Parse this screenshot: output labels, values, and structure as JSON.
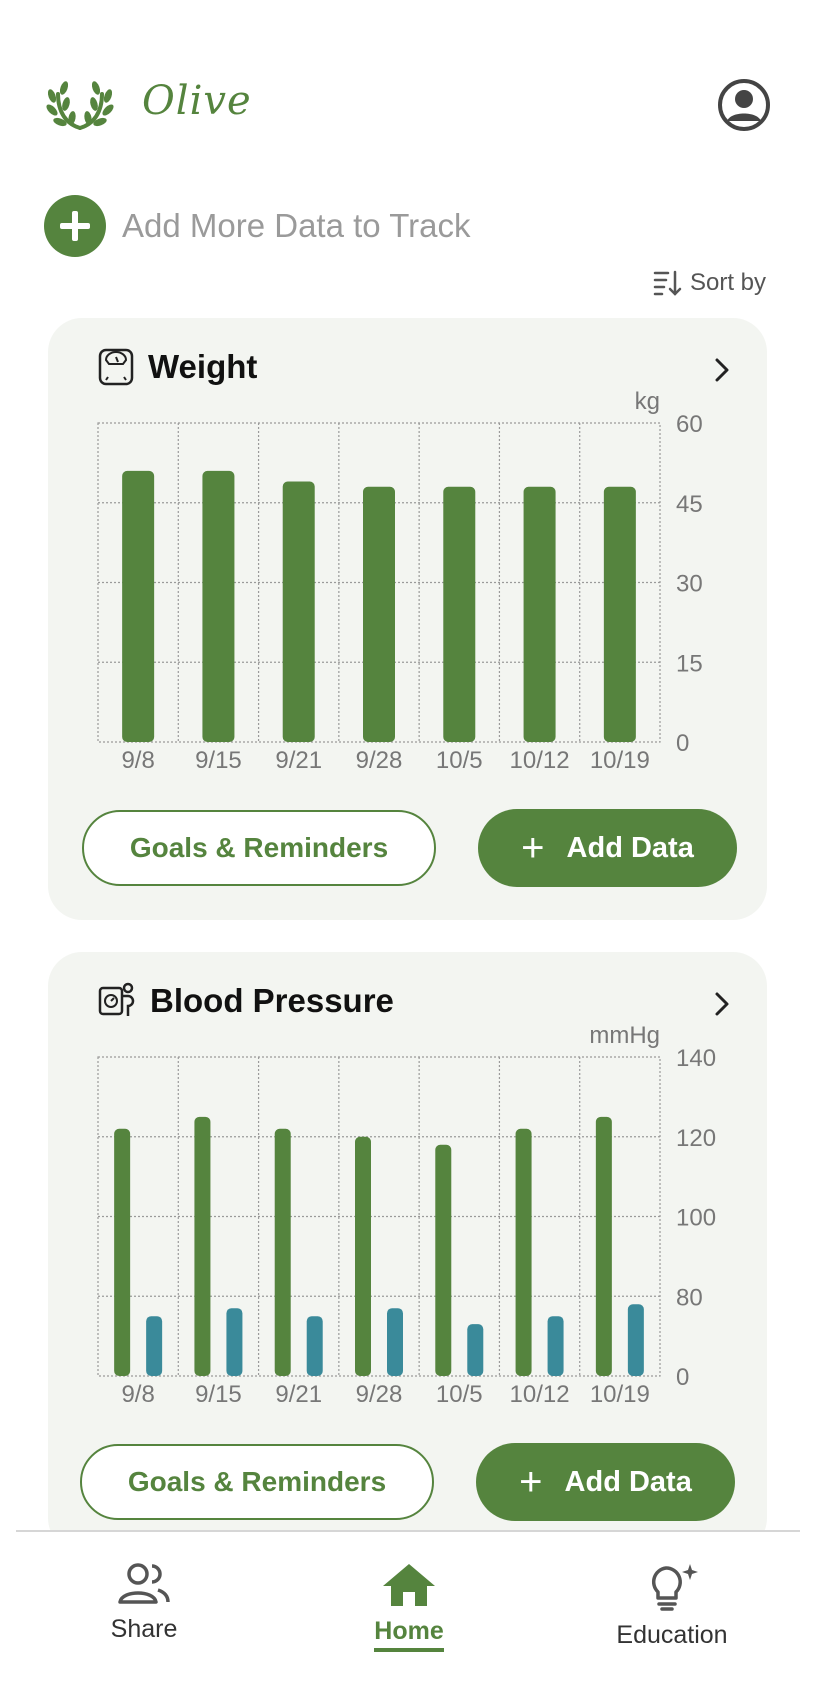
{
  "app": {
    "name": "Olive"
  },
  "header": {
    "logo_icon": "laurel-wreath-icon",
    "profile_icon": "user-circle-icon"
  },
  "add_more": {
    "label": "Add More Data to Track",
    "icon": "plus-circle-icon"
  },
  "sort": {
    "label": "Sort by",
    "icon": "sort-descending-icon"
  },
  "colors": {
    "primary": "#55843e",
    "secondary_bar": "#3a8a9a",
    "card_bg": "#f3f5f1",
    "muted_text": "#9a9a9a"
  },
  "weight_card": {
    "title": "Weight",
    "icon": "scale-icon",
    "goals_label": "Goals & Reminders",
    "add_label": "Add Data",
    "chart_data": {
      "type": "bar",
      "ylabel": "kg",
      "categories": [
        "9/8",
        "9/15",
        "9/21",
        "9/28",
        "10/5",
        "10/12",
        "10/19"
      ],
      "yticks": [
        "0",
        "15",
        "30",
        "45",
        "60"
      ],
      "ylim": [
        0,
        60
      ],
      "grid": true,
      "series": [
        {
          "values": [
            51,
            51,
            49,
            48,
            48,
            48,
            48
          ]
        }
      ]
    }
  },
  "bp_card": {
    "title": "Blood Pressure",
    "icon": "blood-pressure-monitor-icon",
    "goals_label": "Goals & Reminders",
    "add_label": "Add Data",
    "chart_data": {
      "type": "bar",
      "ylabel": "mmHg",
      "categories": [
        "9/8",
        "9/15",
        "9/21",
        "9/28",
        "10/5",
        "10/12",
        "10/19"
      ],
      "yticks": [
        "0",
        "80",
        "100",
        "120",
        "140"
      ],
      "ylim": [
        60,
        140
      ],
      "grid": true,
      "series": [
        {
          "values": [
            122,
            125,
            122,
            120,
            118,
            122,
            125
          ]
        },
        {
          "values": [
            75,
            77,
            75,
            77,
            73,
            75,
            78
          ]
        }
      ]
    }
  },
  "nav": {
    "items": [
      {
        "label": "Share",
        "icon": "people-icon"
      },
      {
        "label": "Home",
        "icon": "home-icon",
        "active": true
      },
      {
        "label": "Education",
        "icon": "lightbulb-sparkle-icon"
      }
    ]
  }
}
